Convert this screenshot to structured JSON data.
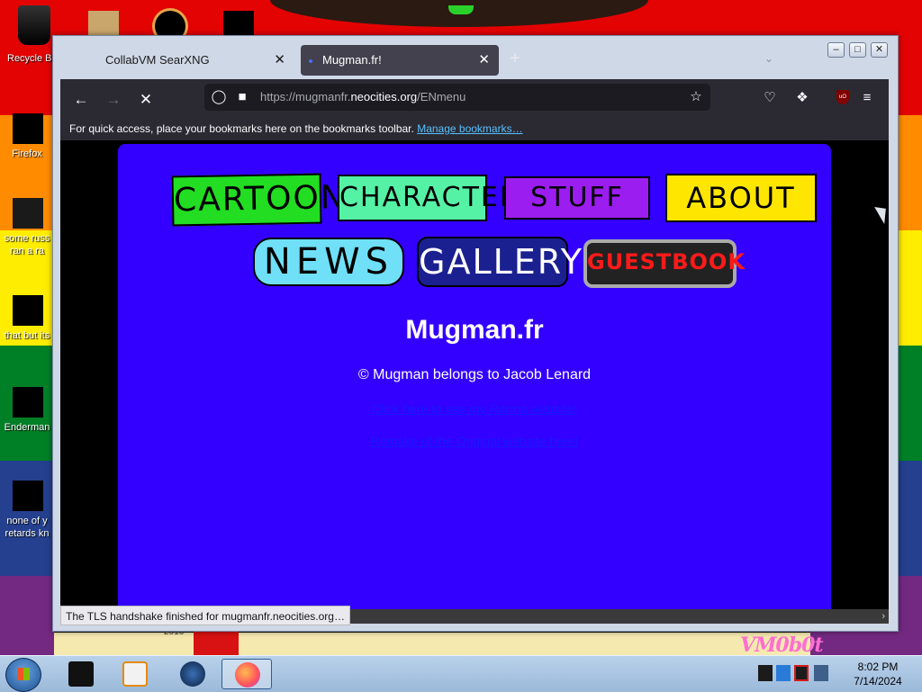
{
  "desktop": {
    "icons": [
      {
        "label": "Recycle B"
      },
      {
        "label": "Firefox"
      },
      {
        "label": "some russ"
      },
      {
        "label": "ran a ra"
      },
      {
        "label": "that but its"
      },
      {
        "label": "Enderman"
      },
      {
        "label": "none of y"
      },
      {
        "label": "retards kn"
      }
    ],
    "wallpaper_year": "2016",
    "wallpaper_logo": "VM0b0t"
  },
  "browser": {
    "tabs": [
      {
        "label": "CollabVM SearXNG",
        "active": false
      },
      {
        "label": "Mugman.fr!",
        "active": true
      }
    ],
    "close_glyph": "✕",
    "new_tab_glyph": "+",
    "url_prefix": "https://mugmanfr.",
    "url_domain": "neocities.org",
    "url_path": "/ENmenu",
    "bookmarks_text": "For quick access, place your bookmarks here on the bookmarks toolbar.",
    "bookmarks_link": "Manage bookmarks…",
    "status_text": "The TLS handshake finished for mugmanfr.neocities.org…",
    "ublock_badge": "uO"
  },
  "page": {
    "nav": [
      "CARTOONS",
      "CHARACTERS",
      "STUFF",
      "ABOUT",
      "NEWS",
      "GALLERY",
      "GUESTBOOK"
    ],
    "title": "Mugman.fr",
    "copyright": "© Mugman belongs to Jacob Lenard",
    "link1": "Click here to see my Rarma website!",
    "link2": "Remake of the Original website here!"
  },
  "taskbar": {
    "time": "8:02 PM",
    "date": "7/14/2024"
  },
  "colors": {
    "page_bg": "#3300ff",
    "browser_chrome": "#2b2a33",
    "link": "#1a17ff"
  }
}
